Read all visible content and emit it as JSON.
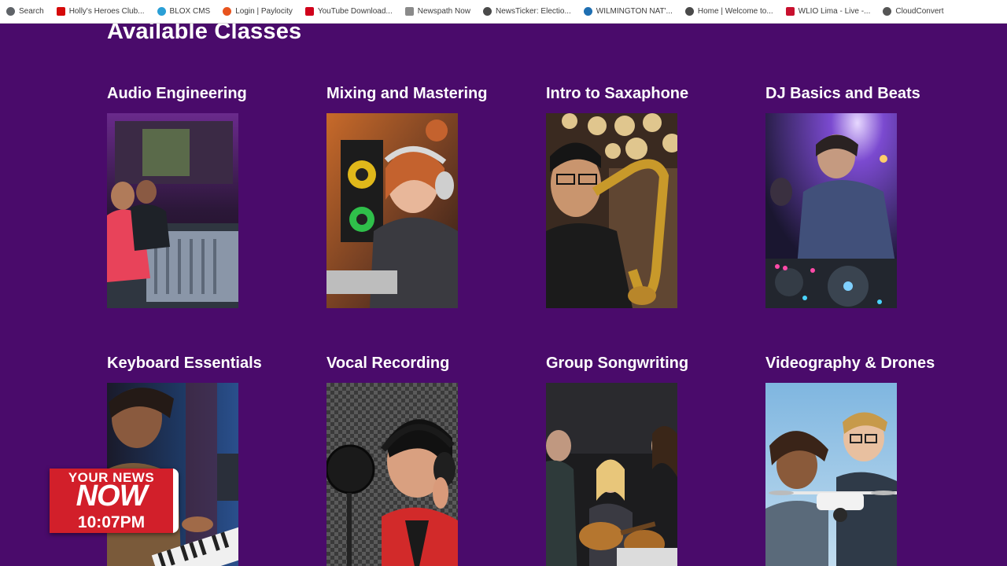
{
  "bookmarks": [
    {
      "label": "Search",
      "icon": "search-icon",
      "color": "#5f6368"
    },
    {
      "label": "Holly's Heroes Club...",
      "icon": "espn-icon",
      "color": "#d50a0a"
    },
    {
      "label": "BLOX CMS",
      "icon": "blox-icon",
      "color": "#2a9fd6"
    },
    {
      "label": "Login | Paylocity",
      "icon": "paylocity-icon",
      "color": "#e8541e"
    },
    {
      "label": "YouTube Download...",
      "icon": "youtube-download-icon",
      "color": "#d0021b"
    },
    {
      "label": "Newspath Now",
      "icon": "document-icon",
      "color": "#8a8a8a"
    },
    {
      "label": "NewsTicker: Electio...",
      "icon": "globe-icon",
      "color": "#4a4a4a"
    },
    {
      "label": "WILMINGTON NAT'...",
      "icon": "bank-icon",
      "color": "#1f6fb2"
    },
    {
      "label": "Home | Welcome to...",
      "icon": "globe-icon",
      "color": "#4a4a4a"
    },
    {
      "label": "WLIO Lima - Live -...",
      "icon": "wlio-icon",
      "color": "#c8102e"
    },
    {
      "label": "CloudConvert",
      "icon": "cloud-icon",
      "color": "#555555"
    }
  ],
  "page": {
    "title": "Available Classes"
  },
  "classes": [
    {
      "title": "Audio Engineering",
      "image": "audio-engineering-photo"
    },
    {
      "title": "Mixing and Mastering",
      "image": "mixing-mastering-photo"
    },
    {
      "title": "Intro to Saxaphone",
      "image": "saxophone-photo"
    },
    {
      "title": "DJ Basics and Beats",
      "image": "dj-photo"
    },
    {
      "title": "Keyboard Essentials",
      "image": "keyboard-photo"
    },
    {
      "title": "Vocal Recording",
      "image": "vocal-recording-photo"
    },
    {
      "title": "Group Songwriting",
      "image": "songwriting-photo"
    },
    {
      "title": "Videography & Drones",
      "image": "drone-photo"
    }
  ],
  "overlay": {
    "line1": "YOUR NEWS",
    "line2": "NOW",
    "time": "10:07PM"
  },
  "colors": {
    "background": "#4a0b6b",
    "badge_red": "#d21f2a"
  }
}
